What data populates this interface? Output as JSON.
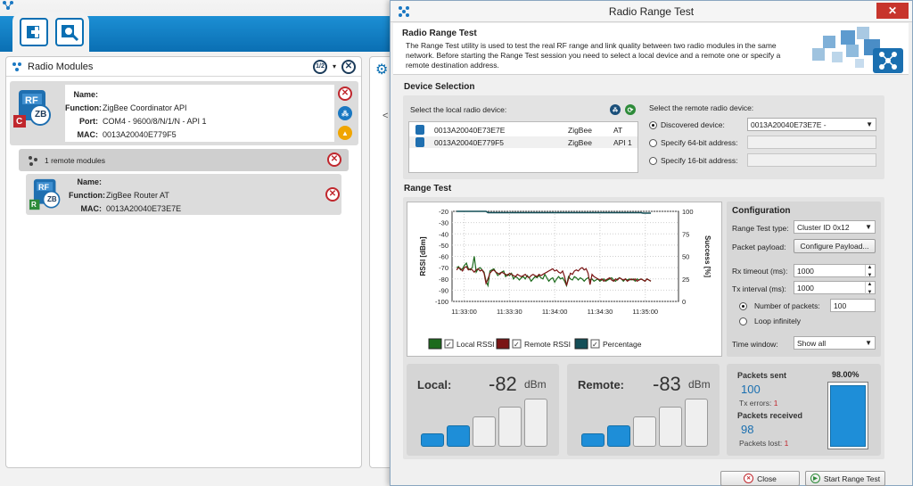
{
  "modules_panel": {
    "title": "Radio Modules",
    "sort_label": "1/2"
  },
  "coordinator": {
    "badge_rf": "RF",
    "badge_zb": "ZB",
    "badge_role": "C",
    "name_key": "Name:",
    "name_val": "",
    "function_key": "Function:",
    "function_val": "ZigBee Coordinator API",
    "port_key": "Port:",
    "port_val": "COM4 - 9600/8/N/1/N - API 1",
    "mac_key": "MAC:",
    "mac_val": "0013A20040E779F5"
  },
  "remote_group": {
    "label": "1 remote modules"
  },
  "router": {
    "badge_rf": "RF",
    "badge_zb": "ZB",
    "badge_role": "R",
    "name_key": "Name:",
    "name_val": "",
    "function_key": "Function:",
    "function_val": "ZigBee Router AT",
    "mac_key": "MAC:",
    "mac_val": "0013A20040E73E7E"
  },
  "dialog": {
    "title": "Radio Range Test",
    "close_glyph": "✕",
    "intro_heading": "Radio Range Test",
    "intro_text": "The Range Test utility is used to test the real RF range and link quality between two radio modules in the same network. Before starting the Range Test session you need to select a local device and a remote one or specify a remote destination address.",
    "device_selection_title": "Device Selection",
    "local_label": "Select the local radio device:",
    "local_devices": [
      {
        "mac": "0013A20040E73E7E",
        "protocol": "ZigBee",
        "mode": "AT"
      },
      {
        "mac": "0013A20040E779F5",
        "protocol": "ZigBee",
        "mode": "API 1"
      }
    ],
    "remote_label": "Select the remote radio device:",
    "discovered_label": "Discovered device:",
    "discovered_value": "0013A20040E73E7E -",
    "addr64_label": "Specify 64-bit address:",
    "addr16_label": "Specify 16-bit address:",
    "range_test_title": "Range Test",
    "config_title": "Configuration",
    "test_type_label": "Range Test type:",
    "test_type_value": "Cluster ID 0x12",
    "payload_label": "Packet payload:",
    "payload_button": "Configure Payload...",
    "rx_timeout_label": "Rx timeout (ms):",
    "rx_timeout_value": "1000",
    "tx_interval_label": "Tx interval (ms):",
    "tx_interval_value": "1000",
    "num_packets_label": "Number of packets:",
    "num_packets_value": "100",
    "loop_label": "Loop infinitely",
    "time_window_label": "Time window:",
    "time_window_value": "Show all",
    "local_sig_label": "Local:",
    "local_sig_value": "-82",
    "local_bars_on": 2,
    "remote_sig_label": "Remote:",
    "remote_sig_value": "-83",
    "remote_bars_on": 2,
    "sig_unit": "dBm",
    "packets_sent_label": "Packets sent",
    "packets_sent_value": "100",
    "tx_errors_label": "Tx errors:",
    "tx_errors_value": "1",
    "packets_received_label": "Packets received",
    "packets_received_value": "98",
    "packets_lost_label": "Packets lost:",
    "packets_lost_value": "1",
    "success_pct_label": "98.00%",
    "success_fraction": 0.98,
    "close_button": "Close",
    "start_button": "Start Range Test"
  },
  "colors": {
    "local_rssi": "#1d6b1d",
    "remote_rssi": "#7a1414",
    "percentage": "#134e57",
    "accent": "#0a6fb3"
  },
  "chart_data": {
    "type": "line",
    "x": [
      "11:33:00",
      "11:33:30",
      "11:34:00",
      "11:34:30",
      "11:35:00"
    ],
    "xlim": [
      "11:32:52",
      "11:35:22"
    ],
    "ylabel": "RSSI [dBm]",
    "ylim": [
      -100,
      -20
    ],
    "yticks": [
      -20,
      -30,
      -40,
      -50,
      -60,
      -70,
      -80,
      -90,
      -100
    ],
    "y2label": "Success [%]",
    "y2lim": [
      0,
      100
    ],
    "y2ticks": [
      100,
      75,
      50,
      25,
      0
    ],
    "grid": true,
    "series": [
      {
        "name": "Local RSSI",
        "axis": "left",
        "color": "#1d6b1d",
        "values": [
          -70,
          -69,
          -72,
          -71,
          -68,
          -66,
          -71,
          -72,
          -70,
          -60,
          -74,
          -71,
          -70,
          -72,
          -74,
          -82,
          -86,
          -73,
          -72,
          -71,
          -74,
          -77,
          -75,
          -74,
          -73,
          -78,
          -76,
          -77,
          -75,
          -80,
          -78,
          -79,
          -81,
          -79,
          -78,
          -80,
          -77,
          -79,
          -82,
          -80,
          -78,
          -79,
          -77,
          -79,
          -80,
          -76,
          -79,
          -82,
          -80,
          -79,
          -83,
          -80,
          -78,
          -80,
          -79,
          -82,
          -86,
          -78,
          -80,
          -81,
          -78,
          -79,
          -81,
          -79,
          -80,
          -82,
          -80,
          -79,
          -81,
          -80,
          -82,
          -81,
          -80,
          -82,
          -81,
          -80,
          -82,
          -81,
          -80,
          -79,
          -81,
          -82,
          -80,
          -79,
          -80,
          -82,
          -80,
          -81,
          -80,
          -81,
          -80,
          -82,
          -80,
          -81,
          -80,
          -81,
          -82,
          -80,
          -81,
          -82
        ]
      },
      {
        "name": "Remote RSSI",
        "axis": "left",
        "color": "#7a1414",
        "values": [
          -72,
          -70,
          -71,
          -73,
          -70,
          -69,
          -72,
          -71,
          -72,
          -74,
          -72,
          -71,
          -73,
          -72,
          -75,
          -84,
          -80,
          -75,
          -73,
          -72,
          -74,
          -75,
          -76,
          -74,
          -75,
          -76,
          -77,
          -75,
          -76,
          -77,
          -78,
          -76,
          -77,
          -78,
          -77,
          -76,
          -78,
          -79,
          -77,
          -76,
          -77,
          -78,
          -76,
          -77,
          -76,
          -75,
          -74,
          -73,
          -72,
          -71,
          -73,
          -72,
          -74,
          -75,
          -73,
          -78,
          -86,
          -80,
          -75,
          -76,
          -73,
          -72,
          -73,
          -71,
          -70,
          -72,
          -71,
          -75,
          -85,
          -76,
          -78,
          -79,
          -80,
          -81,
          -80,
          -82,
          -81,
          -80,
          -79,
          -81,
          -82,
          -80,
          -81,
          -79,
          -80,
          -81,
          -80,
          -82,
          -81,
          -80,
          -81,
          -80,
          -82,
          -81,
          -80,
          -81,
          -82,
          -80,
          -81,
          -82
        ]
      },
      {
        "name": "Percentage",
        "axis": "right",
        "color": "#134e57",
        "values": [
          100,
          100,
          100,
          100,
          100,
          100,
          100,
          100,
          100,
          100,
          100,
          100,
          100,
          100,
          100,
          100,
          98.5,
          98.5,
          98.5,
          98.5,
          98.5,
          98.5,
          98.5,
          98.5,
          98.5,
          98.5,
          98.5,
          98.5,
          98.5,
          98.5,
          98.5,
          98.5,
          98.5,
          98.5,
          98.5,
          98.5,
          98.5,
          98.5,
          98.5,
          98.5,
          98.5,
          98.5,
          98.5,
          98.5,
          98.5,
          98.5,
          98.5,
          98.5,
          98.5,
          98.5,
          98.5,
          98.5,
          98.5,
          98.5,
          98.5,
          98.5,
          98.5,
          98.5,
          98.5,
          98.5,
          98.5,
          98.5,
          98.5,
          98.5,
          98.5,
          98.5,
          98.5,
          98.5,
          98.5,
          98.5,
          98.5,
          98.5,
          98.5,
          98.5,
          98.5,
          98.5,
          98.5,
          98.5,
          98.5,
          98.5,
          98.5,
          98.5,
          98.5,
          98.5,
          98.5,
          98.5,
          98.5,
          98.5,
          98.5,
          98.5,
          98.5,
          98.5,
          98.5,
          98.5,
          98.5,
          98,
          98,
          98,
          98,
          98
        ]
      }
    ],
    "legend": "bottom"
  }
}
